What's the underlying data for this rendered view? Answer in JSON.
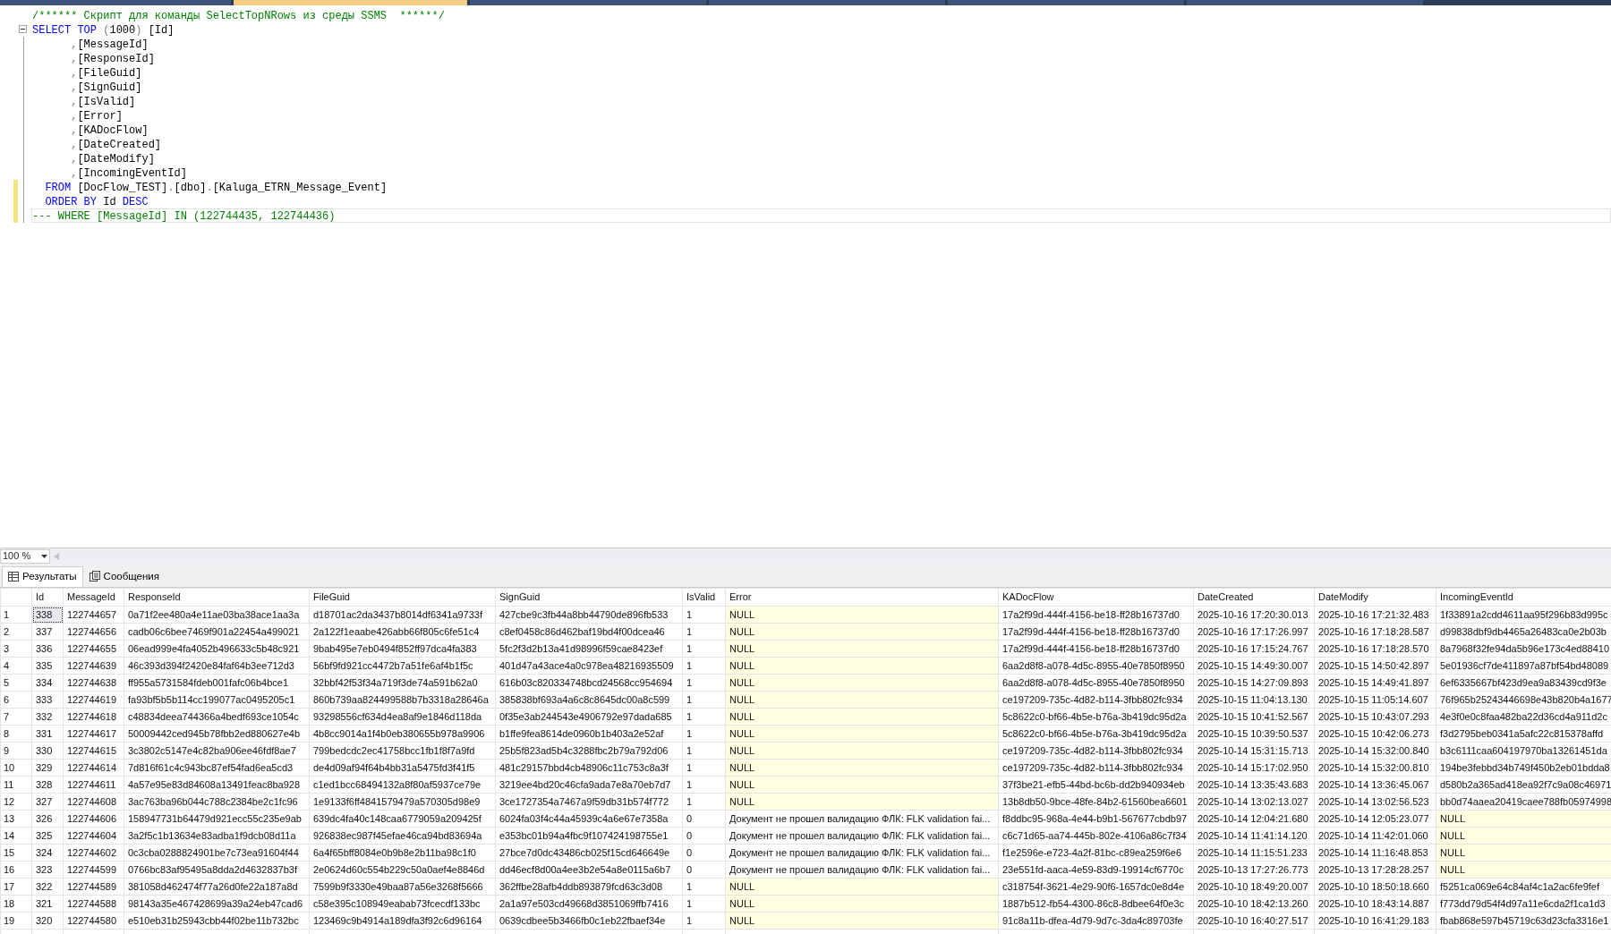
{
  "document_tabs": [
    {
      "selected": false
    },
    {
      "selected": true
    },
    {
      "selected": false
    },
    {
      "selected": false
    },
    {
      "selected": false
    },
    {
      "selected": false
    }
  ],
  "editor": {
    "lines": [
      {
        "changed": false,
        "current": false,
        "fold": false,
        "tokens": [
          {
            "kind": "comment",
            "text": "/****** Скрипт для команды SelectTopNRows из среды SSMS  ******/"
          }
        ]
      },
      {
        "changed": false,
        "current": false,
        "fold": true,
        "tokens": [
          {
            "kind": "keyword",
            "text": "SELECT "
          },
          {
            "kind": "keyword",
            "text": "TOP "
          },
          {
            "kind": "operator",
            "text": "("
          },
          {
            "kind": "plain",
            "text": "1000"
          },
          {
            "kind": "operator",
            "text": ")"
          },
          {
            "kind": "plain",
            "text": " [Id]"
          }
        ]
      },
      {
        "changed": false,
        "current": false,
        "fold": false,
        "tokens": [
          {
            "kind": "operator",
            "text": "      ,"
          },
          {
            "kind": "plain",
            "text": "[MessageId]"
          }
        ]
      },
      {
        "changed": false,
        "current": false,
        "fold": false,
        "tokens": [
          {
            "kind": "operator",
            "text": "      ,"
          },
          {
            "kind": "plain",
            "text": "[ResponseId]"
          }
        ]
      },
      {
        "changed": false,
        "current": false,
        "fold": false,
        "tokens": [
          {
            "kind": "operator",
            "text": "      ,"
          },
          {
            "kind": "plain",
            "text": "[FileGuid]"
          }
        ]
      },
      {
        "changed": false,
        "current": false,
        "fold": false,
        "tokens": [
          {
            "kind": "operator",
            "text": "      ,"
          },
          {
            "kind": "plain",
            "text": "[SignGuid]"
          }
        ]
      },
      {
        "changed": false,
        "current": false,
        "fold": false,
        "tokens": [
          {
            "kind": "operator",
            "text": "      ,"
          },
          {
            "kind": "plain",
            "text": "[IsValid]"
          }
        ]
      },
      {
        "changed": false,
        "current": false,
        "fold": false,
        "tokens": [
          {
            "kind": "operator",
            "text": "      ,"
          },
          {
            "kind": "plain",
            "text": "[Error]"
          }
        ]
      },
      {
        "changed": false,
        "current": false,
        "fold": false,
        "tokens": [
          {
            "kind": "operator",
            "text": "      ,"
          },
          {
            "kind": "plain",
            "text": "[KADocFlow]"
          }
        ]
      },
      {
        "changed": false,
        "current": false,
        "fold": false,
        "tokens": [
          {
            "kind": "operator",
            "text": "      ,"
          },
          {
            "kind": "plain",
            "text": "[DateCreated]"
          }
        ]
      },
      {
        "changed": false,
        "current": false,
        "fold": false,
        "tokens": [
          {
            "kind": "operator",
            "text": "      ,"
          },
          {
            "kind": "plain",
            "text": "[DateModify]"
          }
        ]
      },
      {
        "changed": false,
        "current": false,
        "fold": false,
        "tokens": [
          {
            "kind": "operator",
            "text": "      ,"
          },
          {
            "kind": "plain",
            "text": "[IncomingEventId]"
          }
        ]
      },
      {
        "changed": true,
        "current": false,
        "fold": false,
        "tokens": [
          {
            "kind": "keyword",
            "text": "  FROM"
          },
          {
            "kind": "plain",
            "text": " [DocFlow_TEST]"
          },
          {
            "kind": "operator",
            "text": "."
          },
          {
            "kind": "plain",
            "text": "[dbo]"
          },
          {
            "kind": "operator",
            "text": "."
          },
          {
            "kind": "plain",
            "text": "[Kaluga_ETRN_Message_Event]"
          }
        ]
      },
      {
        "changed": true,
        "current": false,
        "fold": false,
        "tokens": [
          {
            "kind": "keyword",
            "text": "  ORDER BY"
          },
          {
            "kind": "plain",
            "text": " Id "
          },
          {
            "kind": "keyword",
            "text": "DESC"
          }
        ]
      },
      {
        "changed": true,
        "current": true,
        "fold": false,
        "tokens": [
          {
            "kind": "comment",
            "text": "--- WHERE [MessageId] IN (122744435, 122744436)"
          }
        ]
      }
    ]
  },
  "zoom": {
    "value": "100 %"
  },
  "results_tabs": [
    {
      "label": "Результаты",
      "kind": "grid",
      "selected": true
    },
    {
      "label": "Сообщения",
      "kind": "messages",
      "selected": false
    }
  ],
  "grid": {
    "columns": [
      "Id",
      "MessageId",
      "ResponseId",
      "FileGuid",
      "SignGuid",
      "IsValid",
      "Error",
      "KADocFlow",
      "DateCreated",
      "DateModify",
      "IncomingEventId"
    ],
    "rows": [
      {
        "number": "1",
        "selected": true,
        "cells": [
          "338",
          "122744657",
          "0a71f2ee480a4e11ae03ba38ace1aa3a",
          "d18701ac2da3437b8014df6341a9733f",
          "427cbe9c3fb44a8bb44790de896fb533",
          "1",
          {
            "text": "NULL",
            "null": true
          },
          "17a2f99d-444f-4156-be18-ff28b16737d0",
          "2025-10-16 17:20:30.013",
          "2025-10-16 17:21:32.483",
          "1f33891a2cdd4611aa95f296b83d995c"
        ]
      },
      {
        "number": "2",
        "selected": false,
        "cells": [
          "337",
          "122744656",
          "cadb06c6bee7469f901a22454a499021",
          "2a122f1eaabe426abb66f805c6fe51c4",
          "c8ef0458c86d462baf19bd4f00dcea46",
          "1",
          {
            "text": "NULL",
            "null": true
          },
          "17a2f99d-444f-4156-be18-ff28b16737d0",
          "2025-10-16 17:17:26.997",
          "2025-10-16 17:18:28.587",
          "d99838dbf9db4465a26483ca0e2b03b"
        ]
      },
      {
        "number": "3",
        "selected": false,
        "cells": [
          "336",
          "122744655",
          "06ead999e4fa4052b496633c5b48c921",
          "9bab495e7eb0494f852ff97dca4fa383",
          "5fc2f3d2b13a41d98996f59cae8423ef",
          "1",
          {
            "text": "NULL",
            "null": true
          },
          "17a2f99d-444f-4156-be18-ff28b16737d0",
          "2025-10-16 17:15:24.767",
          "2025-10-16 17:18:28.570",
          "8a7968f32fe94da5b96e173c4ed88410"
        ]
      },
      {
        "number": "4",
        "selected": false,
        "cells": [
          "335",
          "122744639",
          "46c393d394f2420e84faf64b3ee712d3",
          "56bf9fd921cc4472b7a51fe6af4b1f5c",
          "401d47a43ace4a0c978ea48216935509",
          "1",
          {
            "text": "NULL",
            "null": true
          },
          "6aa2d8f8-a078-4d5c-8955-40e7850f8950",
          "2025-10-15 14:49:30.007",
          "2025-10-15 14:50:42.897",
          "5e01936cf7de411897a87bf54bd48089"
        ]
      },
      {
        "number": "5",
        "selected": false,
        "cells": [
          "334",
          "122744638",
          "ff955a5731584fdeb001fafc06b4bce1",
          "32bbf42f53f34a719f3de74a591b62a0",
          "616b03c820334748bcd24568cc954694",
          "1",
          {
            "text": "NULL",
            "null": true
          },
          "6aa2d8f8-a078-4d5c-8955-40e7850f8950",
          "2025-10-15 14:27:09.893",
          "2025-10-15 14:49:41.897",
          "6ef6335667bf423d9ea9a83439cd9f3e"
        ]
      },
      {
        "number": "6",
        "selected": false,
        "cells": [
          "333",
          "122744619",
          "fa93bf5b5b114cc199077ac0495205c1",
          "860b739aa824499588b7b3318a28646a",
          "385838bf693a4a6c8c8645dc00a8c599",
          "1",
          {
            "text": "NULL",
            "null": true
          },
          "ce197209-735c-4d82-b114-3fbb802fc934",
          "2025-10-15 11:04:13.130",
          "2025-10-15 11:05:14.607",
          "76f965b25243446698e43b820b4a1677"
        ]
      },
      {
        "number": "7",
        "selected": false,
        "cells": [
          "332",
          "122744618",
          "c48834deea744366a4bedf693ce1054c",
          "93298556cf634d4ea8af9e1846d118da",
          "0f35e3ab244543e4906792e97dada685",
          "1",
          {
            "text": "NULL",
            "null": true
          },
          "5c8622c0-bf66-4b5e-b76a-3b419dc95d2a",
          "2025-10-15 10:41:52.567",
          "2025-10-15 10:43:07.293",
          "4e3f0e0c8faa482ba22d36cd4a911d2c"
        ]
      },
      {
        "number": "8",
        "selected": false,
        "cells": [
          "331",
          "122744617",
          "50009442ced945b78fbb2ed880627e4b",
          "4b8cc9014a1f4b0eb380655b978a9906",
          "b1ffe9fea8614de0960b1b403a2e52af",
          "1",
          {
            "text": "NULL",
            "null": true
          },
          "5c8622c0-bf66-4b5e-b76a-3b419dc95d2a",
          "2025-10-15 10:39:50.537",
          "2025-10-15 10:42:06.273",
          "f3d2795beb0341a5afc22c815378affd"
        ]
      },
      {
        "number": "9",
        "selected": false,
        "cells": [
          "330",
          "122744615",
          "3c3802c5147e4c82ba906ee46fdf8ae7",
          "799bedcdc2ec41758bcc1fb1f8f7a9fd",
          "25b5f823ad5b4c3288fbc2b79a792d06",
          "1",
          {
            "text": "NULL",
            "null": true
          },
          "ce197209-735c-4d82-b114-3fbb802fc934",
          "2025-10-14 15:31:15.713",
          "2025-10-14 15:32:00.840",
          "b3c6111caa604197970ba13261451da"
        ]
      },
      {
        "number": "10",
        "selected": false,
        "cells": [
          "329",
          "122744614",
          "7d816f61c4c943bc87ef54fad6ea5cd3",
          "de4d09af94f64b4bb31a5475fd3f41f5",
          "481c29157bbd4cb48906c11c753c8a3f",
          "1",
          {
            "text": "NULL",
            "null": true
          },
          "ce197209-735c-4d82-b114-3fbb802fc934",
          "2025-10-14 15:17:02.950",
          "2025-10-14 15:32:00.810",
          "194be3febbd34b749f450b2eb01bdda8"
        ]
      },
      {
        "number": "11",
        "selected": false,
        "cells": [
          "328",
          "122744611",
          "4a57e95e83d84608a13491feac8ba928",
          "c1ed1bcc68494132a8f80af5937ce79e",
          "3219ee4bd20c46cfa9ada7e8a70eb7d7",
          "1",
          {
            "text": "NULL",
            "null": true
          },
          "37f3be21-efb5-44bd-bc6b-dd2b940934eb",
          "2025-10-14 13:35:43.683",
          "2025-10-14 13:36:45.067",
          "d580b2a365ad418ea92f7c9a08c46971"
        ]
      },
      {
        "number": "12",
        "selected": false,
        "cells": [
          "327",
          "122744608",
          "3ac763ba96b044c788c2384be2c1fc96",
          "1e9133f6ff4841579479a570305d98e9",
          "3ce1727354a7467a9f59db31b574f772",
          "1",
          {
            "text": "NULL",
            "null": true
          },
          "13b8db50-9bce-48fe-84b2-61560bea6601",
          "2025-10-14 13:02:13.027",
          "2025-10-14 13:02:56.523",
          "bb0d74aaea20419caee788fb05974998"
        ]
      },
      {
        "number": "13",
        "selected": false,
        "cells": [
          "326",
          "122744606",
          "158947731b64479d921ecc55c235e9ab",
          "639dc4fa40c148caa6779059a209425f",
          "6024fa03f4c44a45939c4a6e67e7358a",
          "0",
          "Документ не прошел валидацию ФЛК: FLK validation fai...",
          "f8ddbc95-968a-4e44-b9b1-567677cbdb97",
          "2025-10-14 12:04:21.680",
          "2025-10-14 12:05:23.077",
          {
            "text": "NULL",
            "null": true
          }
        ]
      },
      {
        "number": "14",
        "selected": false,
        "cells": [
          "325",
          "122744604",
          "3a2f5c1b13634e83adba1f9dcb08d11a",
          "926838ec987f45efae46ca94bd83694a",
          "e353bc01b94a4fbc9f107424198755e1",
          "0",
          "Документ не прошел валидацию ФЛК: FLK validation fai...",
          "c6c71d65-aa74-445b-802e-4106a86c7f34",
          "2025-10-14 11:41:14.120",
          "2025-10-14 11:42:01.060",
          {
            "text": "NULL",
            "null": true
          }
        ]
      },
      {
        "number": "15",
        "selected": false,
        "cells": [
          "324",
          "122744602",
          "0c3cba0288824901be7c73ea91604f44",
          "6a4f65bff8084e0b9b8e2b11ba98c1f0",
          "27bce7d0dc43486cb025f15cd646649e",
          "0",
          "Документ не прошел валидацию ФЛК: FLK validation fai...",
          "f1e2596e-e723-4a2f-81bc-c89ea259f6e6",
          "2025-10-14 11:15:51.233",
          "2025-10-14 11:16:48.853",
          {
            "text": "NULL",
            "null": true
          }
        ]
      },
      {
        "number": "16",
        "selected": false,
        "cells": [
          "323",
          "122744599",
          "0766bc83af95495a8dda2d4632837b3f",
          "2e0624d60c554b229c50a0aef4e8846d",
          "dd46ecf8d00a4ee3b2e54a8e0115a6b7",
          "0",
          "Документ не прошел валидацию ФЛК: FLK validation fai...",
          "23e551fd-aaca-4e59-83d9-19914cf6770c",
          "2025-10-13 17:27:26.773",
          "2025-10-13 17:28:28.257",
          {
            "text": "NULL",
            "null": true
          }
        ]
      },
      {
        "number": "17",
        "selected": false,
        "cells": [
          "322",
          "122744589",
          "381058d462474f77a26d0fe22a187a8d",
          "7599b9f3330e49baa87a56e3268f5666",
          "362ffbe28afb4ddb893879fcd63c3d08",
          "1",
          {
            "text": "NULL",
            "null": true
          },
          "c318754f-3621-4e29-90f6-1657dc0e8d4e",
          "2025-10-10 18:49:20.007",
          "2025-10-10 18:50:18.660",
          "f5251ca069e64c84af4c1a2ac6fe9fef"
        ]
      },
      {
        "number": "18",
        "selected": false,
        "cells": [
          "321",
          "122744588",
          "98143a35e467428699a39a24eb47cad6",
          "c58e395c108949eabab73fcecdf133bc",
          "2a1a97e503cd49668d3851069ffb7416",
          "1",
          {
            "text": "NULL",
            "null": true
          },
          "1887b512-fb54-4300-86c8-8dbee64f0e3c",
          "2025-10-10 18:42:13.260",
          "2025-10-10 18:43:14.887",
          "f773dd79d54f4d97a11e6cda2f1ca1d3"
        ]
      },
      {
        "number": "19",
        "selected": false,
        "cells": [
          "320",
          "122744580",
          "e510eb31b25943cbb44f02be11b732bc",
          "123469c9b4914a189dfa3f92c6d96164",
          "0639cdbee5b3466fb0c1eb22fbaef34e",
          "1",
          {
            "text": "NULL",
            "null": true
          },
          "91c8a11b-dfea-4d79-9d7c-3da4c89703fe",
          "2025-10-10 16:40:27.517",
          "2025-10-10 16:41:29.183",
          "fbab868e597b45719c63d23cfa3316e1"
        ]
      }
    ]
  }
}
